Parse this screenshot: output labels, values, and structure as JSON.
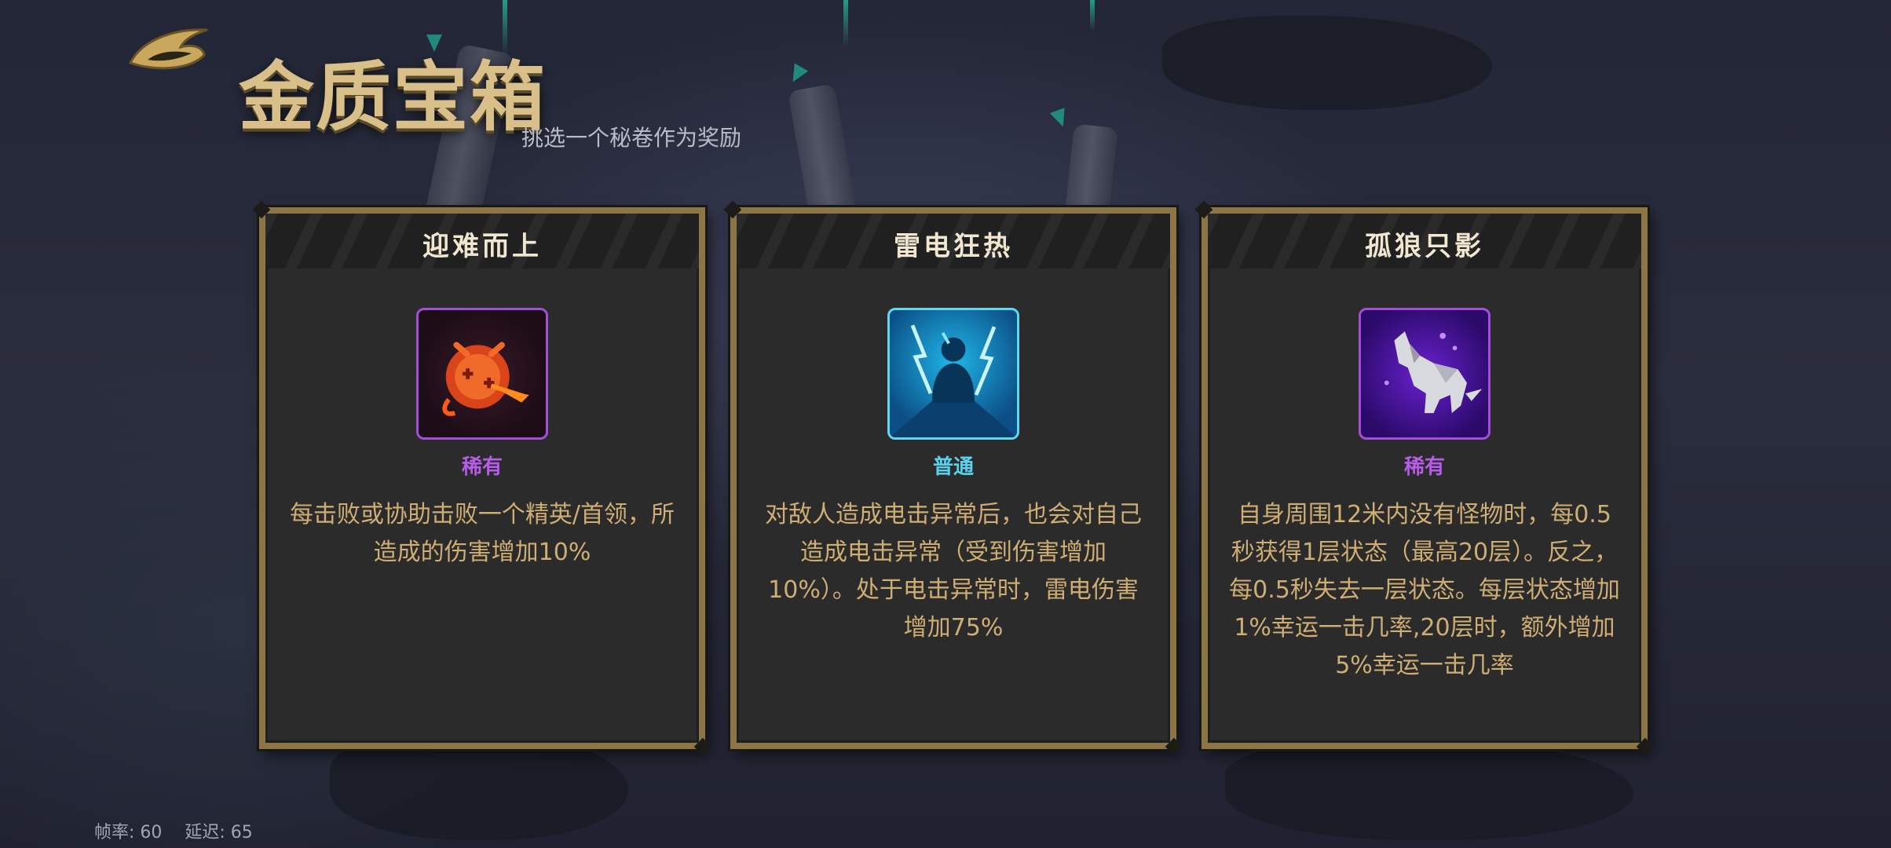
{
  "header": {
    "title": "金质宝箱",
    "subtitle": "挑选一个秘卷作为奖励",
    "logo_icon": "gold-wing-emblem-icon"
  },
  "cards": [
    {
      "title": "迎难而上",
      "icon": "flaming-orb-arrow-icon",
      "rarity": "稀有",
      "rarity_color": "#b65ce8",
      "description": "每击败或协助击败一个精英/首领，所造成的伤害增加10%"
    },
    {
      "title": "雷电狂热",
      "icon": "lightning-figure-icon",
      "rarity": "普通",
      "rarity_color": "#57d2ec",
      "description": "对敌人造成电击异常后，也会对自己造成电击异常（受到伤害增加10%）。处于电击异常时，雷电伤害增加75%"
    },
    {
      "title": "孤狼只影",
      "icon": "howling-wolf-icon",
      "rarity": "稀有",
      "rarity_color": "#b65ce8",
      "description": "自身周围12米内没有怪物时，每0.5秒获得1层状态（最高20层）。反之，每0.5秒失去一层状态。每层状态增加1%幸运一击几率,20层时，额外增加5%幸运一击几率"
    }
  ],
  "stats": {
    "fps_label": "帧率: 60",
    "latency_label": "延迟: 65"
  },
  "colors": {
    "card_border": "#8c7546",
    "description_text": "#cfae74",
    "title_gold": "#d9c08a"
  }
}
